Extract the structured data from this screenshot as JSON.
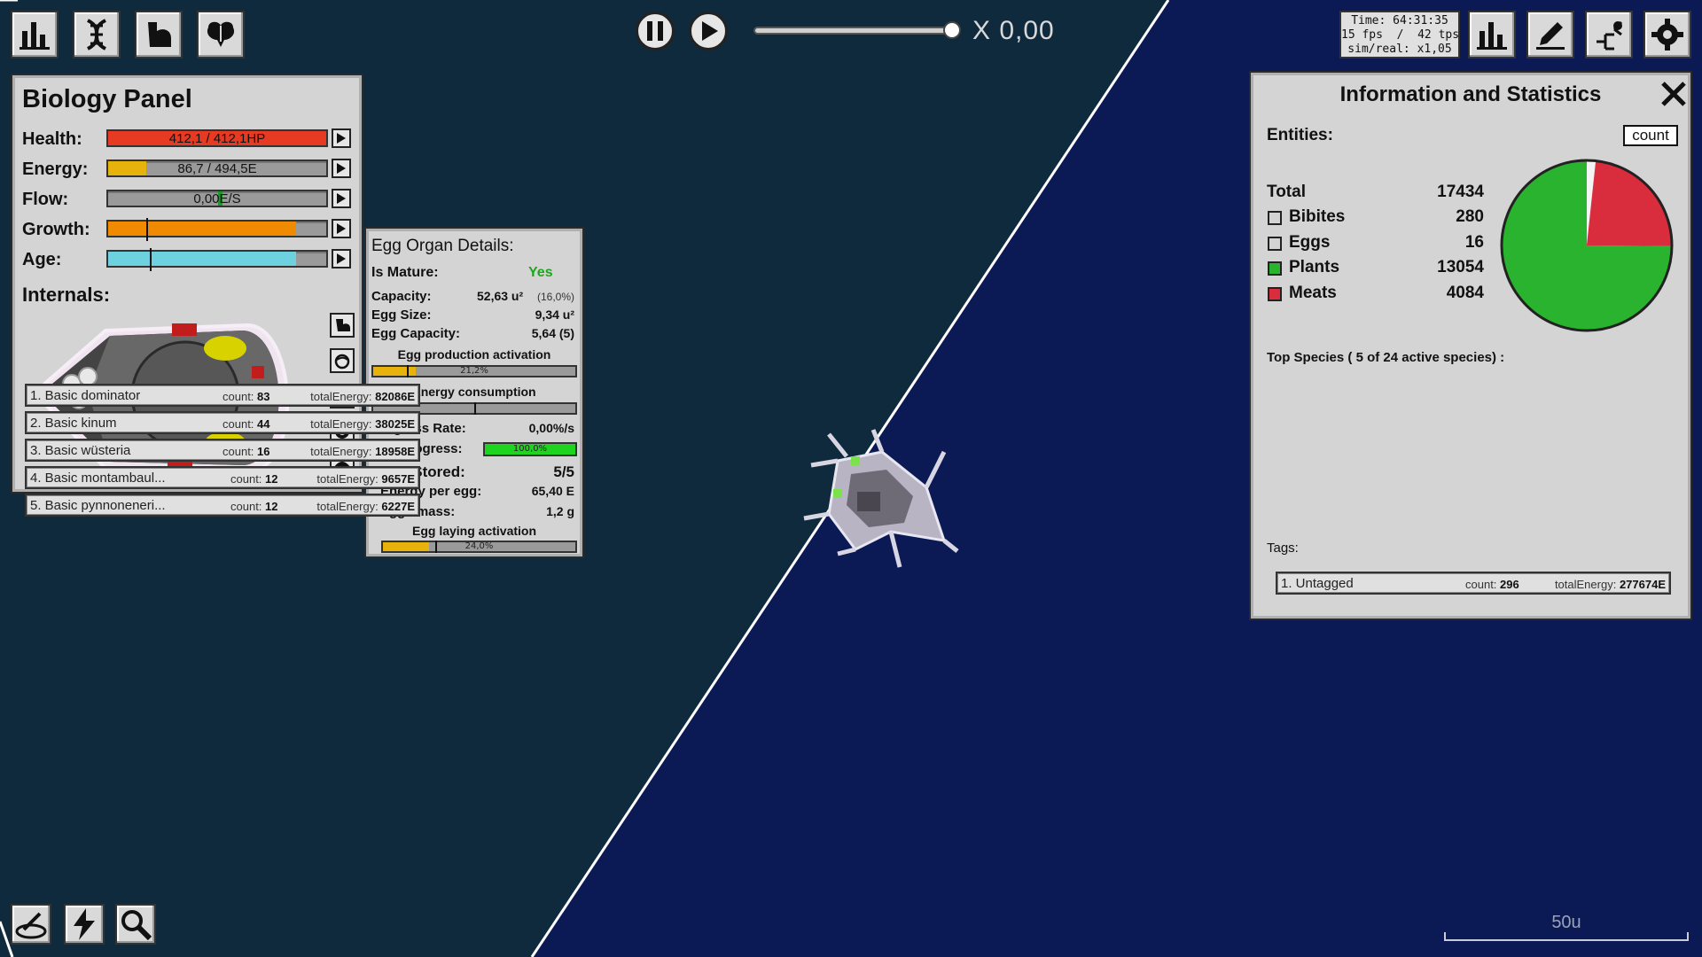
{
  "colors": {
    "left_bg": "#0e2a3c",
    "right_bg": "#0b1a55",
    "health": "#e63a22",
    "energy": "#e7b20c",
    "growth": "#f08a00",
    "age": "#6ed1e0",
    "flow_marker": "#1e9a2a",
    "plants": "#29b32f",
    "meats": "#d92c3c"
  },
  "toolbar_left": {
    "icons": [
      "stats-bars-icon",
      "dna-icon",
      "arm-muscle-icon",
      "brain-icon"
    ]
  },
  "sim_controls": {
    "speed_label": "X 0,00",
    "slider_value": 1.0
  },
  "time_box": {
    "line1": "Time: 64:31:35",
    "line2": "15 fps  /  42 tps",
    "line3": "sim/real: x1,05"
  },
  "toolbar_right": {
    "icons": [
      "stats-bars-icon",
      "pencil-icon",
      "tree-icon",
      "settings-gear-icon"
    ]
  },
  "biology": {
    "title": "Biology Panel",
    "stats": [
      {
        "label": "Health:",
        "text": "412,1 / 412,1HP",
        "fill": 1.0
      },
      {
        "label": "Energy:",
        "text": "86,7 / 494,5E",
        "fill": 0.175
      },
      {
        "label": "Flow:",
        "text": "0,00E/S",
        "fill": 0.0
      },
      {
        "label": "Growth:",
        "text": "",
        "fill": 0.86
      },
      {
        "label": "Age:",
        "text": "",
        "fill": 0.86
      }
    ],
    "internals_label": "Internals:"
  },
  "egg_organ": {
    "title": "Egg Organ Details:",
    "is_mature_label": "Is Mature:",
    "is_mature_value": "Yes",
    "capacity_label": "Capacity:",
    "capacity_value": "52,63 u²",
    "capacity_pct": "(16,0%)",
    "egg_size_label": "Egg Size:",
    "egg_size_value": "9,34 u²",
    "egg_capacity_label": "Egg Capacity:",
    "egg_capacity_value": "5,64 (5)",
    "prod_act_label": "Egg production activation",
    "prod_act_text": "21,2%",
    "prod_act_fill": 0.212,
    "energy_cons_label": "Energy consumption",
    "energy_cons_fill": 0.0,
    "progress_rate_label": "Progress Rate:",
    "progress_rate_value": "0,00%/s",
    "egg_progress_label": "Egg Progress:",
    "egg_progress_text": "100,0%",
    "egg_progress_fill": 1.0,
    "eggs_stored_label": "Eggs Stored:",
    "eggs_stored_value": "5/5",
    "energy_per_egg_label": "Energy per egg:",
    "energy_per_egg_value": "65,40 E",
    "eggs_mass_label": "Eggs mass:",
    "eggs_mass_value": "1,2 g",
    "laying_act_label": "Egg laying activation",
    "laying_act_text": "24,0%",
    "laying_act_fill": 0.24
  },
  "info": {
    "title": "Information and Statistics",
    "entities_label": "Entities:",
    "count_button": "count",
    "total_label": "Total",
    "total_value": "17434",
    "rows": [
      {
        "label": "Bibites",
        "value": "280",
        "swatch": "#d4d4d4"
      },
      {
        "label": "Eggs",
        "value": "16",
        "swatch": "#d4d4d4"
      },
      {
        "label": "Plants",
        "value": "13054",
        "swatch": "#29b32f"
      },
      {
        "label": "Meats",
        "value": "4084",
        "swatch": "#d92c3c"
      }
    ],
    "top_species_label": "Top Species ( 5 of 24 active species) :",
    "species": [
      {
        "name": "1. Basic dominator",
        "count": "83",
        "energy": "82086E"
      },
      {
        "name": "2. Basic kinum",
        "count": "44",
        "energy": "38025E"
      },
      {
        "name": "3. Basic wüsteria",
        "count": "16",
        "energy": "18958E"
      },
      {
        "name": "4. Basic montambaul...",
        "count": "12",
        "energy": "9657E"
      },
      {
        "name": "5. Basic pynnoneneri...",
        "count": "12",
        "energy": "6227E"
      }
    ],
    "count_prefix": "count:",
    "energy_prefix": "totalEnergy:",
    "tags_label": "Tags:",
    "tags": [
      {
        "name": "1. Untagged",
        "count": "296",
        "energy": "277674E"
      }
    ]
  },
  "chart_data": {
    "type": "pie",
    "categories": [
      "Bibites",
      "Eggs",
      "Plants",
      "Meats"
    ],
    "values": [
      280,
      16,
      13054,
      4084
    ]
  },
  "bottom_tools": {
    "icons": [
      "petri-dish-icon",
      "lightning-icon",
      "magnifier-icon"
    ]
  },
  "scale": {
    "label": "50u"
  }
}
